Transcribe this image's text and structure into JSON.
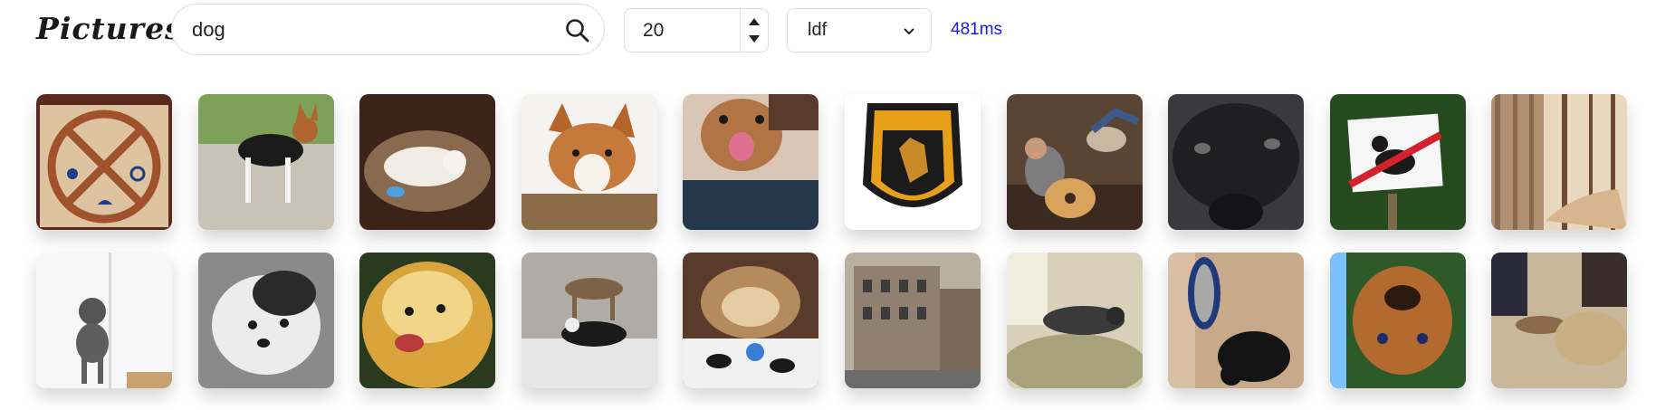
{
  "header": {
    "logo": "Pictures",
    "search": {
      "value": "dog"
    },
    "count": {
      "value": "20"
    },
    "model": {
      "selected": "ldf"
    },
    "timing": "481ms"
  },
  "colors": {
    "timing": "#1a1adb",
    "border": "#dcdcdc"
  },
  "results": [
    {
      "name": "result-image-no-dogs-prohibition-sign"
    },
    {
      "name": "result-image-basenji-on-gravel"
    },
    {
      "name": "result-image-white-dog-in-bed"
    },
    {
      "name": "result-image-corgi-mix-portrait"
    },
    {
      "name": "result-image-boxer-upside-down"
    },
    {
      "name": "result-image-norfolk-k9-police-patch"
    },
    {
      "name": "result-image-man-with-guitar-and-dog"
    },
    {
      "name": "result-image-black-dog-closeup"
    },
    {
      "name": "result-image-no-dog-fouling-sign"
    },
    {
      "name": "result-image-tree-trunk-forest"
    },
    {
      "name": "result-image-gray-poodle-standing"
    },
    {
      "name": "result-image-bw-puppy-portrait"
    },
    {
      "name": "result-image-pomeranian-face"
    },
    {
      "name": "result-image-dogs-reflection"
    },
    {
      "name": "result-image-yorkie-with-toy"
    },
    {
      "name": "result-image-old-stone-street"
    },
    {
      "name": "result-image-dog-sleeping-on-couch"
    },
    {
      "name": "result-image-black-dog-with-drum"
    },
    {
      "name": "result-image-dachshund-upside-down"
    },
    {
      "name": "result-image-dog-in-living-room"
    }
  ]
}
